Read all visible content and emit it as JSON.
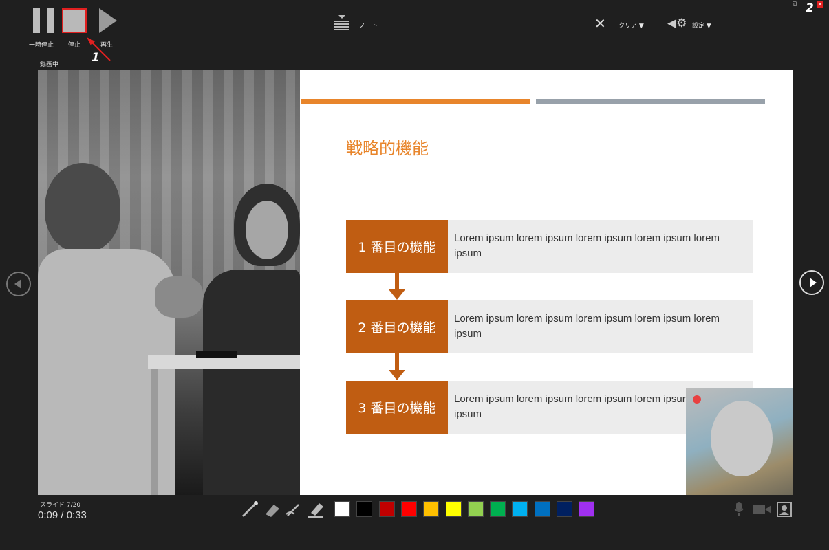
{
  "toolbar": {
    "pause_label": "一時停止",
    "stop_label": "停止",
    "play_label": "再生",
    "notes_label": "ノート",
    "clear_label": "クリア ▼",
    "settings_label": "設定 ▼"
  },
  "window_controls": {
    "minimize": "–",
    "restore": "⧉",
    "close": "✕"
  },
  "callouts": {
    "one": "1",
    "two": "2"
  },
  "status": {
    "recording": "録画中",
    "slide_counter": "スライド 7/20",
    "time": "0:09 / 0:33"
  },
  "slide": {
    "title": "戦略的機能",
    "accent_color": "#e8852b",
    "bar_gray": "#98a1aa",
    "features": [
      {
        "label": "1 番目の機能",
        "desc": "Lorem ipsum lorem ipsum lorem ipsum lorem ipsum lorem ipsum"
      },
      {
        "label": "2 番目の機能",
        "desc": "Lorem ipsum lorem ipsum lorem ipsum lorem ipsum lorem ipsum"
      },
      {
        "label": "3 番目の機能",
        "desc": "Lorem ipsum lorem ipsum lorem ipsum lorem ipsum lorem ipsum"
      }
    ]
  },
  "palette": [
    "#ffffff",
    "#000000",
    "#c00000",
    "#ff0000",
    "#ffc000",
    "#ffff00",
    "#92d050",
    "#00b050",
    "#00b0f0",
    "#0070c0",
    "#002060",
    "#a030f0"
  ],
  "tools": [
    "laser-pointer-icon",
    "eraser-icon",
    "pen-icon",
    "highlighter-icon"
  ],
  "icons": {
    "mic": "microphone-icon",
    "camera": "camera-icon",
    "preview": "camera-preview-icon"
  }
}
